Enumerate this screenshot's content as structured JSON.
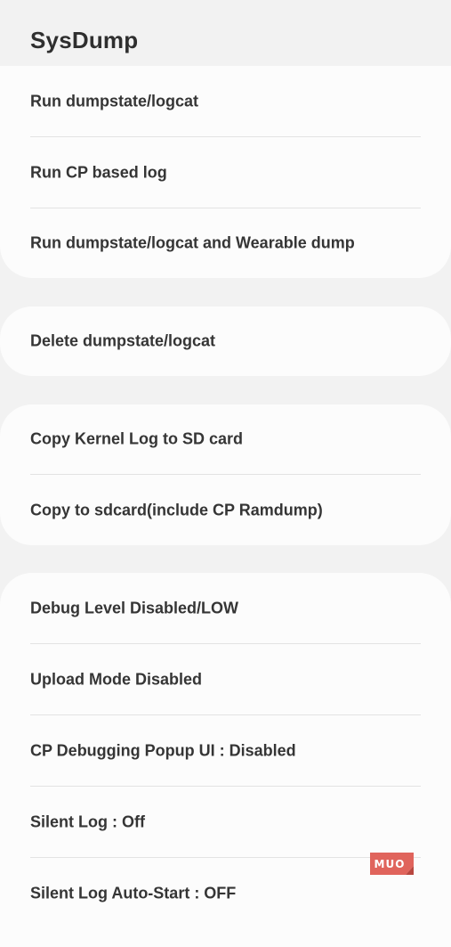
{
  "header": {
    "title": "SysDump"
  },
  "groups": [
    {
      "items": [
        {
          "label": "Run dumpstate/logcat"
        },
        {
          "label": "Run CP based log"
        },
        {
          "label": "Run dumpstate/logcat and Wearable dump"
        }
      ]
    },
    {
      "items": [
        {
          "label": "Delete dumpstate/logcat"
        }
      ]
    },
    {
      "items": [
        {
          "label": "Copy Kernel Log to SD card"
        },
        {
          "label": "Copy to sdcard(include CP Ramdump)"
        }
      ]
    },
    {
      "items": [
        {
          "label": "Debug Level Disabled/LOW"
        },
        {
          "label": "Upload Mode Disabled"
        },
        {
          "label": "CP Debugging Popup UI : Disabled"
        },
        {
          "label": "Silent Log : Off"
        },
        {
          "label": "Silent Log Auto-Start : OFF"
        }
      ]
    }
  ],
  "watermark": {
    "text": "MUO",
    "color": "#e0645c"
  },
  "colors": {
    "background": "#f2f2f2",
    "card": "#fcfcfc",
    "text": "#353535",
    "divider": "#e3e3e3"
  }
}
